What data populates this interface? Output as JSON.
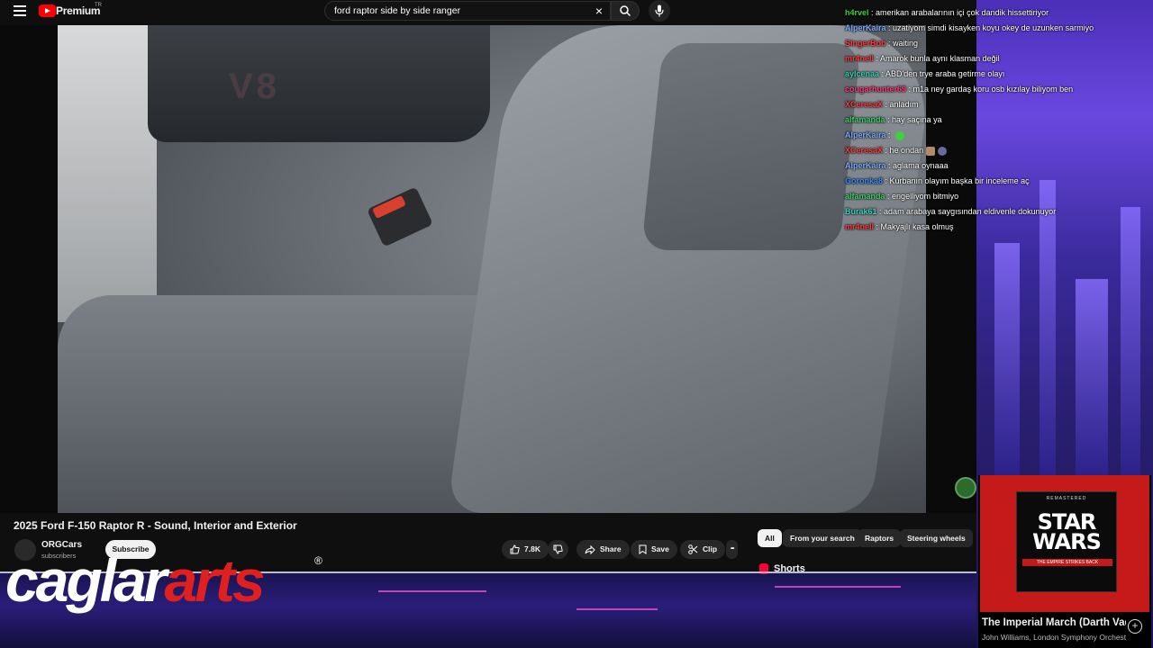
{
  "topbar": {
    "brand": "Premium",
    "brand_sup": "TR",
    "search_query": "ford raptor side by side ranger",
    "clear_icon": "×"
  },
  "video": {
    "overlay_text": "V8"
  },
  "chat": [
    {
      "user": "h4rvel",
      "user_color": "#3ad33a",
      "msg": "amerikan arabalarının içi çok dandik hissettiriyor"
    },
    {
      "user": "AlperKaira",
      "user_color": "#7aa8ff",
      "msg": "uzatiyom simdi kisayken koyu okey de uzunken sarmiyo"
    },
    {
      "user": "SingerBob",
      "user_color": "#ff3b3b",
      "msg": "waiting"
    },
    {
      "user": "mr4nell",
      "user_color": "#ff3b3b",
      "msg": "Amarok bunla aynı klasman değil"
    },
    {
      "user": "aylcenaa",
      "user_color": "#2fd3b0",
      "msg": "ABD'den trye araba getirme olayı"
    },
    {
      "user": "cougarhunter69",
      "user_color": "#ff3b7a",
      "msg": "m1a ney gardaş koru osb kızılay biliyom ben"
    },
    {
      "user": "XCeresaX",
      "user_color": "#ff3b3b",
      "msg": "anladım"
    },
    {
      "user": "alfamanda",
      "user_color": "#3ad36a",
      "msg": "hay saçına ya"
    },
    {
      "user": "AlperKaira",
      "user_color": "#7aa8ff",
      "msg": ""
    },
    {
      "user": "XCeresaX",
      "user_color": "#ff3b3b",
      "msg": "he ondan"
    },
    {
      "user": "AlperKaira",
      "user_color": "#7aa8ff",
      "msg": "aglama oynaaa"
    },
    {
      "user": "Goronka8",
      "user_color": "#3a8cff",
      "msg": "Kurbanın olayım başka bir inceleme aç"
    },
    {
      "user": "alfamanda",
      "user_color": "#3ad36a",
      "msg": "engelliyom bitmiyo"
    },
    {
      "user": "Burak61",
      "user_color": "#3ad3c0",
      "msg": "adam arabaya saygısından eldivenle dokunuyor"
    },
    {
      "user": "mr4nell",
      "user_color": "#ff3b3b",
      "msg": "Makyajlı kasa olmuş"
    }
  ],
  "below": {
    "title": "2025 Ford F-150 Raptor R - Sound, Interior and Exterior",
    "channel": "ORGCars",
    "subs": "subscribers",
    "subscribe": "Subscribe",
    "likes": "7.8K",
    "share": "Share",
    "save": "Save",
    "clip": "Clip",
    "more": "•••"
  },
  "chips": [
    "All",
    "From your search",
    "Raptors",
    "Steering wheels"
  ],
  "shorts": "Shorts",
  "logo": {
    "white": "caglar",
    "red": "arts",
    "reg": "®"
  },
  "music": {
    "remastered": "REMASTERED",
    "album_title_1": "STAR",
    "album_title_2": "WARS",
    "album_sub": "THE EMPIRE STRIKES BACK",
    "track": "The Imperial March (Darth Vader's Theme)",
    "artist": "John Williams, London Symphony Orchestra"
  }
}
